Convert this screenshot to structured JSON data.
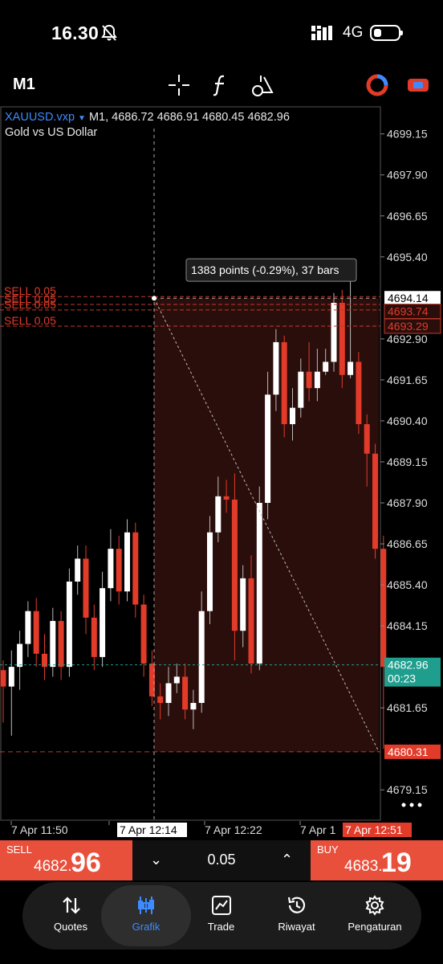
{
  "status": {
    "time": "16.30",
    "network": "4G"
  },
  "toolbar": {
    "timeframe": "M1",
    "icons": [
      "crosshair-icon",
      "function-icon",
      "objects-icon",
      "account-icon",
      "link-icon"
    ]
  },
  "chart": {
    "symbol": "XAUUSD.vxp",
    "timeframe": "M1,",
    "ohlc": "4686.72 4686.91 4680.45 4682.96",
    "description": "Gold vs US Dollar",
    "measure_label": "1383 points (-0.29%), 37 bars",
    "price_labels": [
      "4699.15",
      "4697.90",
      "4696.65",
      "4695.40",
      "4692.90",
      "4691.65",
      "4690.40",
      "4689.15",
      "4687.90",
      "4686.65",
      "4685.40",
      "4684.15",
      "4681.65",
      "4679.15"
    ],
    "ylim": [
      4678.2,
      4700.0
    ],
    "current_price": "4682.96",
    "countdown": "00:23",
    "crosshair_price": "4694.14",
    "order_lines": [
      {
        "label": "SELL 0.05",
        "price": 4694.19
      },
      {
        "label": "SELL 0.05",
        "price": 4693.95
      },
      {
        "label": "SELL 0.05",
        "price": 4693.78
      },
      {
        "label": "SELL 0.05",
        "price": 4693.29
      }
    ],
    "order_price_tags": [
      "4693.74",
      "4693.29"
    ],
    "target_price": "4680.31",
    "time_labels": [
      "7 Apr 11:50",
      "7 Apr 12:22",
      "7 Apr 1"
    ],
    "time_crosshair": "7 Apr 12:14",
    "time_last": "7 Apr 12:51",
    "colors": {
      "bull": "#ffffff",
      "bear": "#e23b2a",
      "accent": "#3d8bff",
      "sell": "#e9503c",
      "current": "#1f9e8e",
      "zone": "#2a0e0b"
    },
    "candles": [
      [
        4682.8,
        4682.3,
        4683.1,
        4681.2
      ],
      [
        4682.3,
        4682.9,
        4683.4,
        4680.8
      ],
      [
        4682.9,
        4683.6,
        4684.0,
        4682.2
      ],
      [
        4683.6,
        4684.6,
        4684.9,
        4683.2
      ],
      [
        4684.6,
        4683.3,
        4685.0,
        4682.9
      ],
      [
        4683.3,
        4682.9,
        4683.9,
        4682.5
      ],
      [
        4682.9,
        4684.3,
        4684.7,
        4682.6
      ],
      [
        4684.3,
        4682.9,
        4684.6,
        4682.5
      ],
      [
        4682.9,
        4685.5,
        4685.9,
        4682.6
      ],
      [
        4685.5,
        4686.2,
        4686.6,
        4685.1
      ],
      [
        4686.2,
        4684.4,
        4686.6,
        4683.9
      ],
      [
        4684.4,
        4683.2,
        4684.8,
        4682.8
      ],
      [
        4683.2,
        4685.3,
        4685.8,
        4682.9
      ],
      [
        4685.3,
        4686.5,
        4687.1,
        4684.9
      ],
      [
        4686.5,
        4685.2,
        4686.9,
        4684.8
      ],
      [
        4685.2,
        4687.0,
        4687.4,
        4684.9
      ],
      [
        4687.0,
        4684.8,
        4687.3,
        4684.4
      ],
      [
        4684.8,
        4683.0,
        4685.1,
        4682.6
      ],
      [
        4683.0,
        4682.0,
        4683.4,
        4681.7
      ],
      [
        4682.0,
        4681.8,
        4682.4,
        4681.3
      ],
      [
        4681.8,
        4682.4,
        4682.9,
        4681.4
      ],
      [
        4682.4,
        4682.6,
        4683.0,
        4682.1
      ],
      [
        4682.6,
        4681.6,
        4683.0,
        4681.3
      ],
      [
        4681.6,
        4681.8,
        4682.2,
        4681.0
      ],
      [
        4681.8,
        4684.6,
        4685.2,
        4681.5
      ],
      [
        4684.6,
        4687.0,
        4687.5,
        4684.2
      ],
      [
        4687.0,
        4688.1,
        4688.7,
        4686.7
      ],
      [
        4688.1,
        4688.0,
        4688.6,
        4687.6
      ],
      [
        4688.0,
        4684.0,
        4688.8,
        4683.1
      ],
      [
        4684.0,
        4685.6,
        4686.0,
        4683.5
      ],
      [
        4685.6,
        4683.0,
        4686.3,
        4682.7
      ],
      [
        4683.0,
        4687.9,
        4688.4,
        4682.8
      ],
      [
        4687.9,
        4691.2,
        4691.9,
        4687.4
      ],
      [
        4691.2,
        4692.8,
        4693.2,
        4690.7
      ],
      [
        4692.8,
        4690.3,
        4693.0,
        4689.9
      ],
      [
        4690.3,
        4690.8,
        4691.4,
        4689.8
      ],
      [
        4690.8,
        4691.9,
        4692.3,
        4690.5
      ],
      [
        4691.9,
        4691.4,
        4692.8,
        4691.0
      ],
      [
        4691.4,
        4691.9,
        4692.6,
        4691.0
      ],
      [
        4691.9,
        4692.2,
        4692.6,
        4691.8
      ],
      [
        4692.2,
        4694.0,
        4694.3,
        4691.9
      ],
      [
        4694.0,
        4691.8,
        4694.4,
        4691.4
      ],
      [
        4691.8,
        4692.2,
        4694.7,
        4691.7
      ],
      [
        4692.2,
        4690.3,
        4692.5,
        4690.0
      ],
      [
        4690.3,
        4689.4,
        4690.6,
        4688.4
      ],
      [
        4689.4,
        4686.5,
        4689.7,
        4686.2
      ],
      [
        4686.5,
        4682.9,
        4686.9,
        4680.4
      ]
    ]
  },
  "trade": {
    "sell_label": "SELL",
    "sell_small": "4682.",
    "sell_big": "96",
    "buy_label": "BUY",
    "buy_small": "4683.",
    "buy_big": "19",
    "lot": "0.05"
  },
  "nav": [
    {
      "label": "Quotes"
    },
    {
      "label": "Grafik"
    },
    {
      "label": "Trade"
    },
    {
      "label": "Riwayat"
    },
    {
      "label": "Pengaturan"
    }
  ]
}
